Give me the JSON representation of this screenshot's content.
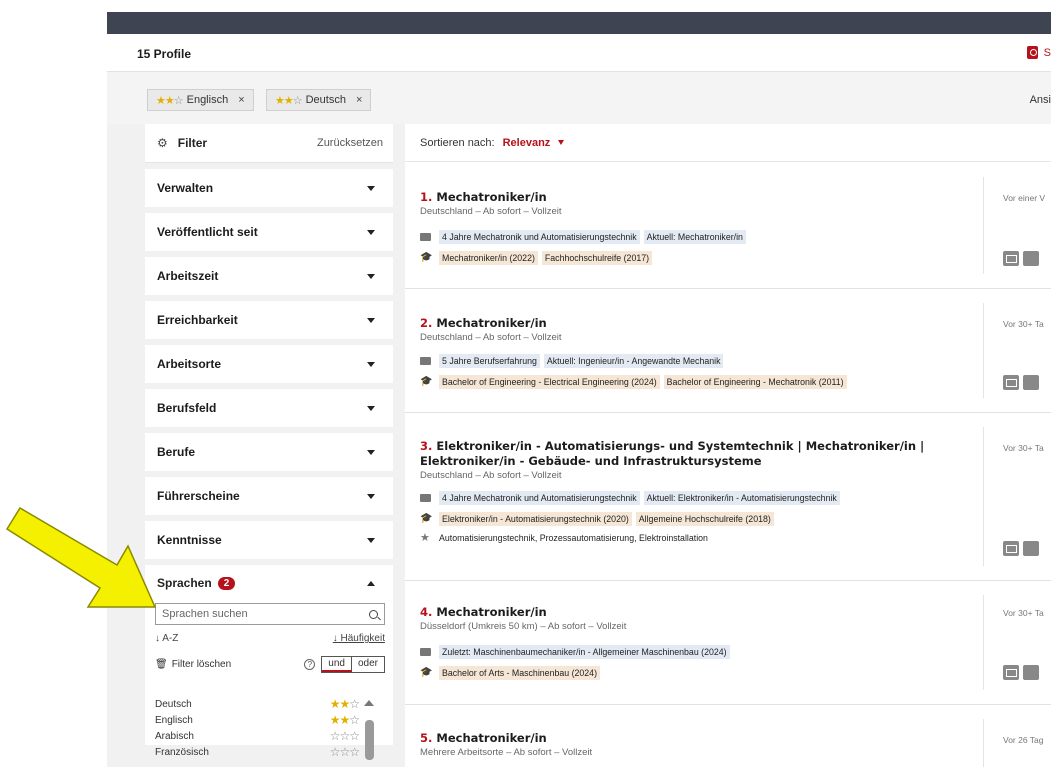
{
  "header": {
    "profile_count": "15 Profile",
    "save_label": "S"
  },
  "chips": [
    {
      "label": "Englisch",
      "stars": "★★☆",
      "remove": "×"
    },
    {
      "label": "Deutsch",
      "stars": "★★☆",
      "remove": "×"
    }
  ],
  "view_label": "Ansi",
  "sidebar": {
    "filter_title": "Filter",
    "reset_label": "Zurücksetzen",
    "sections": [
      "Verwalten",
      "Veröffentlicht seit",
      "Arbeitszeit",
      "Erreichbarkeit",
      "Arbeitsorte",
      "Berufsfeld",
      "Berufe",
      "Führerscheine",
      "Kenntnisse"
    ],
    "languages": {
      "title": "Sprachen",
      "badge": "2",
      "search_placeholder": "Sprachen suchen",
      "sort_az": "↓ A-Z",
      "sort_freq": "↓ Häufigkeit",
      "clear_label": "Filter löschen",
      "help": "?",
      "toggle_and": "und",
      "toggle_or": "oder",
      "items": [
        {
          "name": "Deutsch",
          "on": "★★",
          "off": "☆"
        },
        {
          "name": "Englisch",
          "on": "★★",
          "off": "☆"
        },
        {
          "name": "Arabisch",
          "on": "",
          "off": "☆☆☆"
        },
        {
          "name": "Französisch",
          "on": "",
          "off": "☆☆☆"
        }
      ]
    }
  },
  "results": {
    "sort_label": "Sortieren nach:",
    "sort_value": "Relevanz",
    "cards": [
      {
        "num": "1.",
        "title": "Mechatroniker/in",
        "meta": "Deutschland – Ab sofort – Vollzeit",
        "date": "Vor einer V",
        "experience": [
          "4 Jahre Mechatronik und Automatisierungstechnik",
          "Aktuell: Mechatroniker/in"
        ],
        "education": [
          "Mechatroniker/in (2022)",
          "Fachhochschulreife (2017)"
        ],
        "skills": ""
      },
      {
        "num": "2.",
        "title": "Mechatroniker/in",
        "meta": "Deutschland – Ab sofort – Vollzeit",
        "date": "Vor 30+ Ta",
        "experience": [
          "5 Jahre Berufserfahrung",
          "Aktuell: Ingenieur/in - Angewandte Mechanik"
        ],
        "education": [
          "Bachelor of Engineering - Electrical Engineering (2024)",
          "Bachelor of Engineering - Mechatronik (2011)"
        ],
        "skills": ""
      },
      {
        "num": "3.",
        "title": "Elektroniker/in - Automatisierungs- und Systemtechnik  |  Mechatroniker/in  |  Elektroniker/in - Gebäude- und Infrastruktursysteme",
        "meta": "Deutschland – Ab sofort – Vollzeit",
        "date": "Vor 30+ Ta",
        "experience": [
          "4 Jahre Mechatronik und Automatisierungstechnik",
          "Aktuell: Elektroniker/in - Automatisierungstechnik"
        ],
        "education": [
          "Elektroniker/in - Automatisierungstechnik (2020)",
          "Allgemeine Hochschulreife (2018)"
        ],
        "skills": "Automatisierungstechnik, Prozessautomatisierung, Elektroinstallation"
      },
      {
        "num": "4.",
        "title": "Mechatroniker/in",
        "meta": "Düsseldorf (Umkreis 50 km) – Ab sofort – Vollzeit",
        "date": "Vor 30+ Ta",
        "experience": [
          "Zuletzt: Maschinenbaumechaniker/in - Allgemeiner Maschinenbau (2024)"
        ],
        "education": [
          "Bachelor of Arts - Maschinenbau (2024)"
        ],
        "skills": ""
      },
      {
        "num": "5.",
        "title": "Mechatroniker/in",
        "meta": "Mehrere Arbeitsorte – Ab sofort – Vollzeit",
        "date": "Vor 26 Tag",
        "experience": [],
        "education": [],
        "skills": ""
      }
    ]
  },
  "colors": {
    "accent": "#b5121b",
    "topbar": "#3e4452",
    "arrow_fill": "#f5f000"
  }
}
